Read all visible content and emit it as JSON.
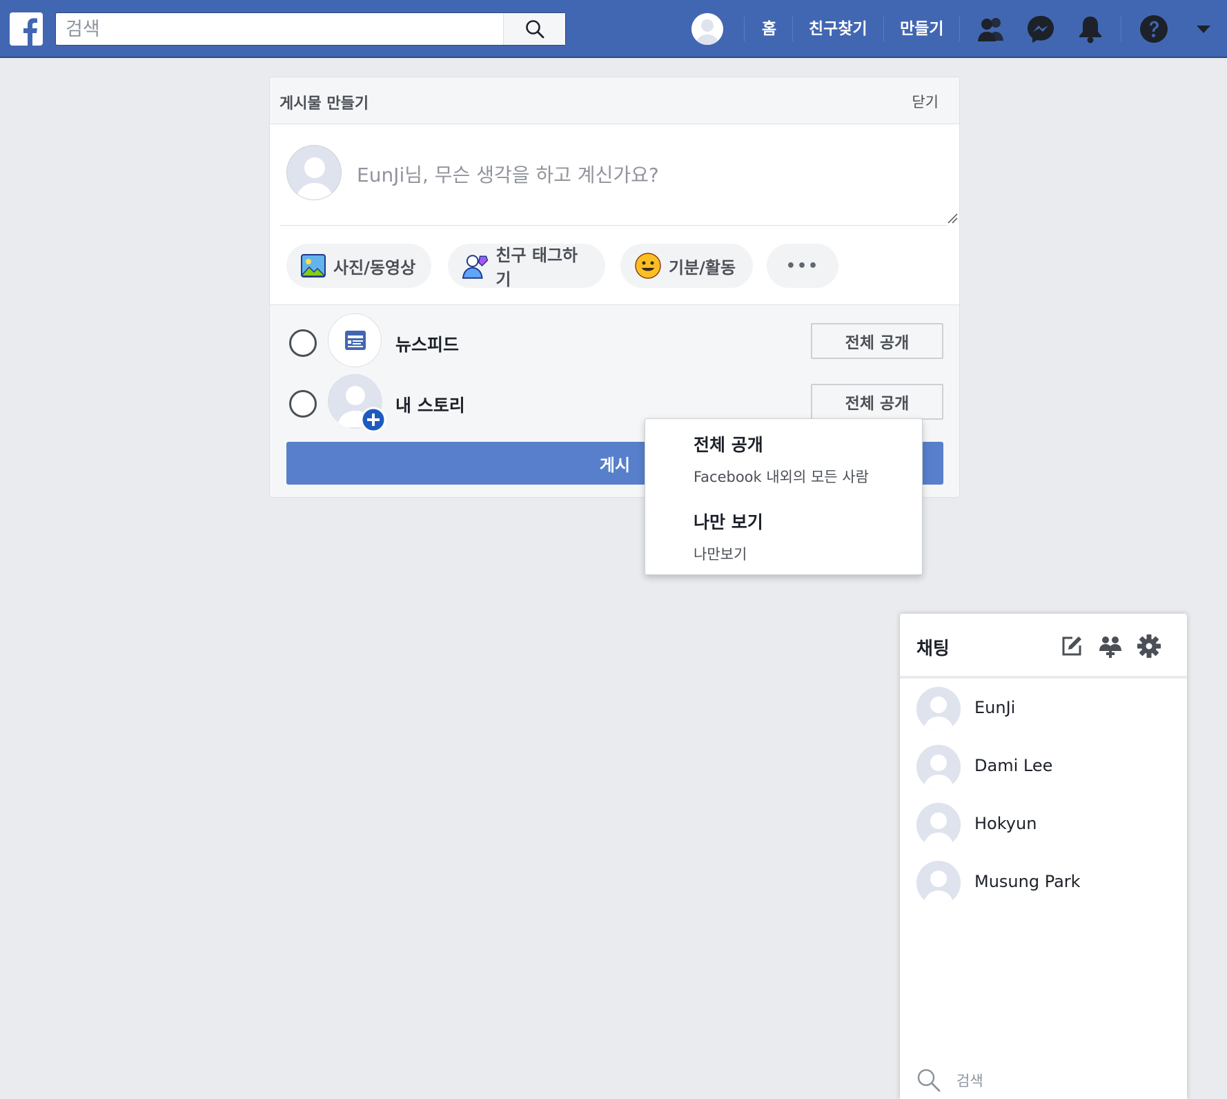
{
  "topbar": {
    "search_placeholder": "검색",
    "links": {
      "home": "홈",
      "find_friends": "친구찾기",
      "create": "만들기"
    }
  },
  "composer": {
    "title": "게시물 만들기",
    "close": "닫기",
    "prompt": "EunJi님, 무슨 생각을 하고 계신가요?",
    "chips": {
      "photo": "사진/동영상",
      "tag": "친구 태그하기",
      "feeling": "기분/활동",
      "more": "•••"
    },
    "destinations": [
      {
        "label": "뉴스피드",
        "audience": "전체 공개"
      },
      {
        "label": "내 스토리",
        "audience": "전체 공개"
      }
    ],
    "post_button": "게시"
  },
  "audience_dropdown": {
    "options": [
      {
        "title": "전체 공개",
        "subtitle": "Facebook 내외의 모든 사람"
      },
      {
        "title": "나만 보기",
        "subtitle": "나만보기"
      }
    ]
  },
  "chat": {
    "title": "채팅",
    "contacts": [
      "EunJi",
      "Dami Lee",
      "Hokyun",
      "Musung Park"
    ],
    "search_placeholder": "검색"
  },
  "colors": {
    "brand": "#4267b2",
    "post_button": "#577fcb",
    "background": "#e9ebee"
  }
}
